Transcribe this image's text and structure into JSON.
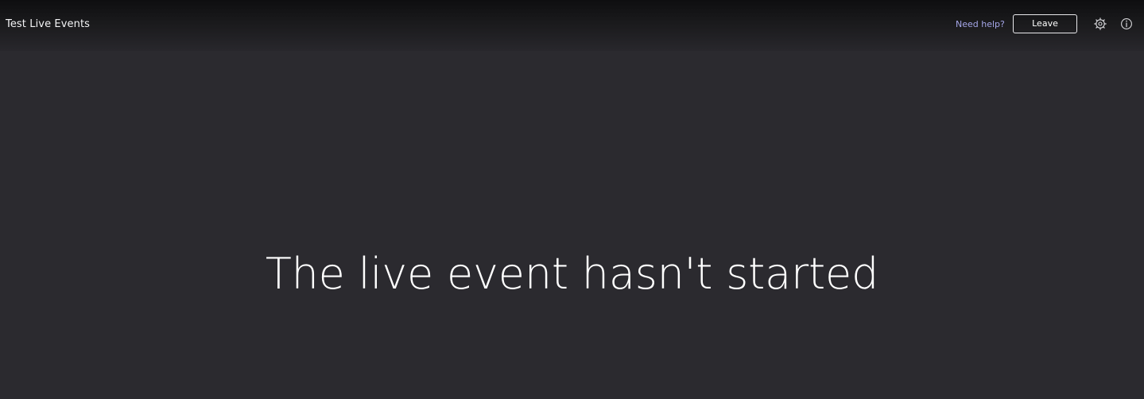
{
  "app": {
    "title": "Test Live Events"
  },
  "header": {
    "help_link": "Need help?",
    "leave_label": "Leave",
    "settings_icon": "gear-icon",
    "info_icon": "info-icon"
  },
  "main": {
    "status_message": "The live event hasn't started"
  },
  "colors": {
    "background": "#2b2a2f",
    "header_top": "#0e0e10",
    "text": "#ffffff",
    "link": "#a5a6e8",
    "button_border": "#e9e9ec"
  }
}
